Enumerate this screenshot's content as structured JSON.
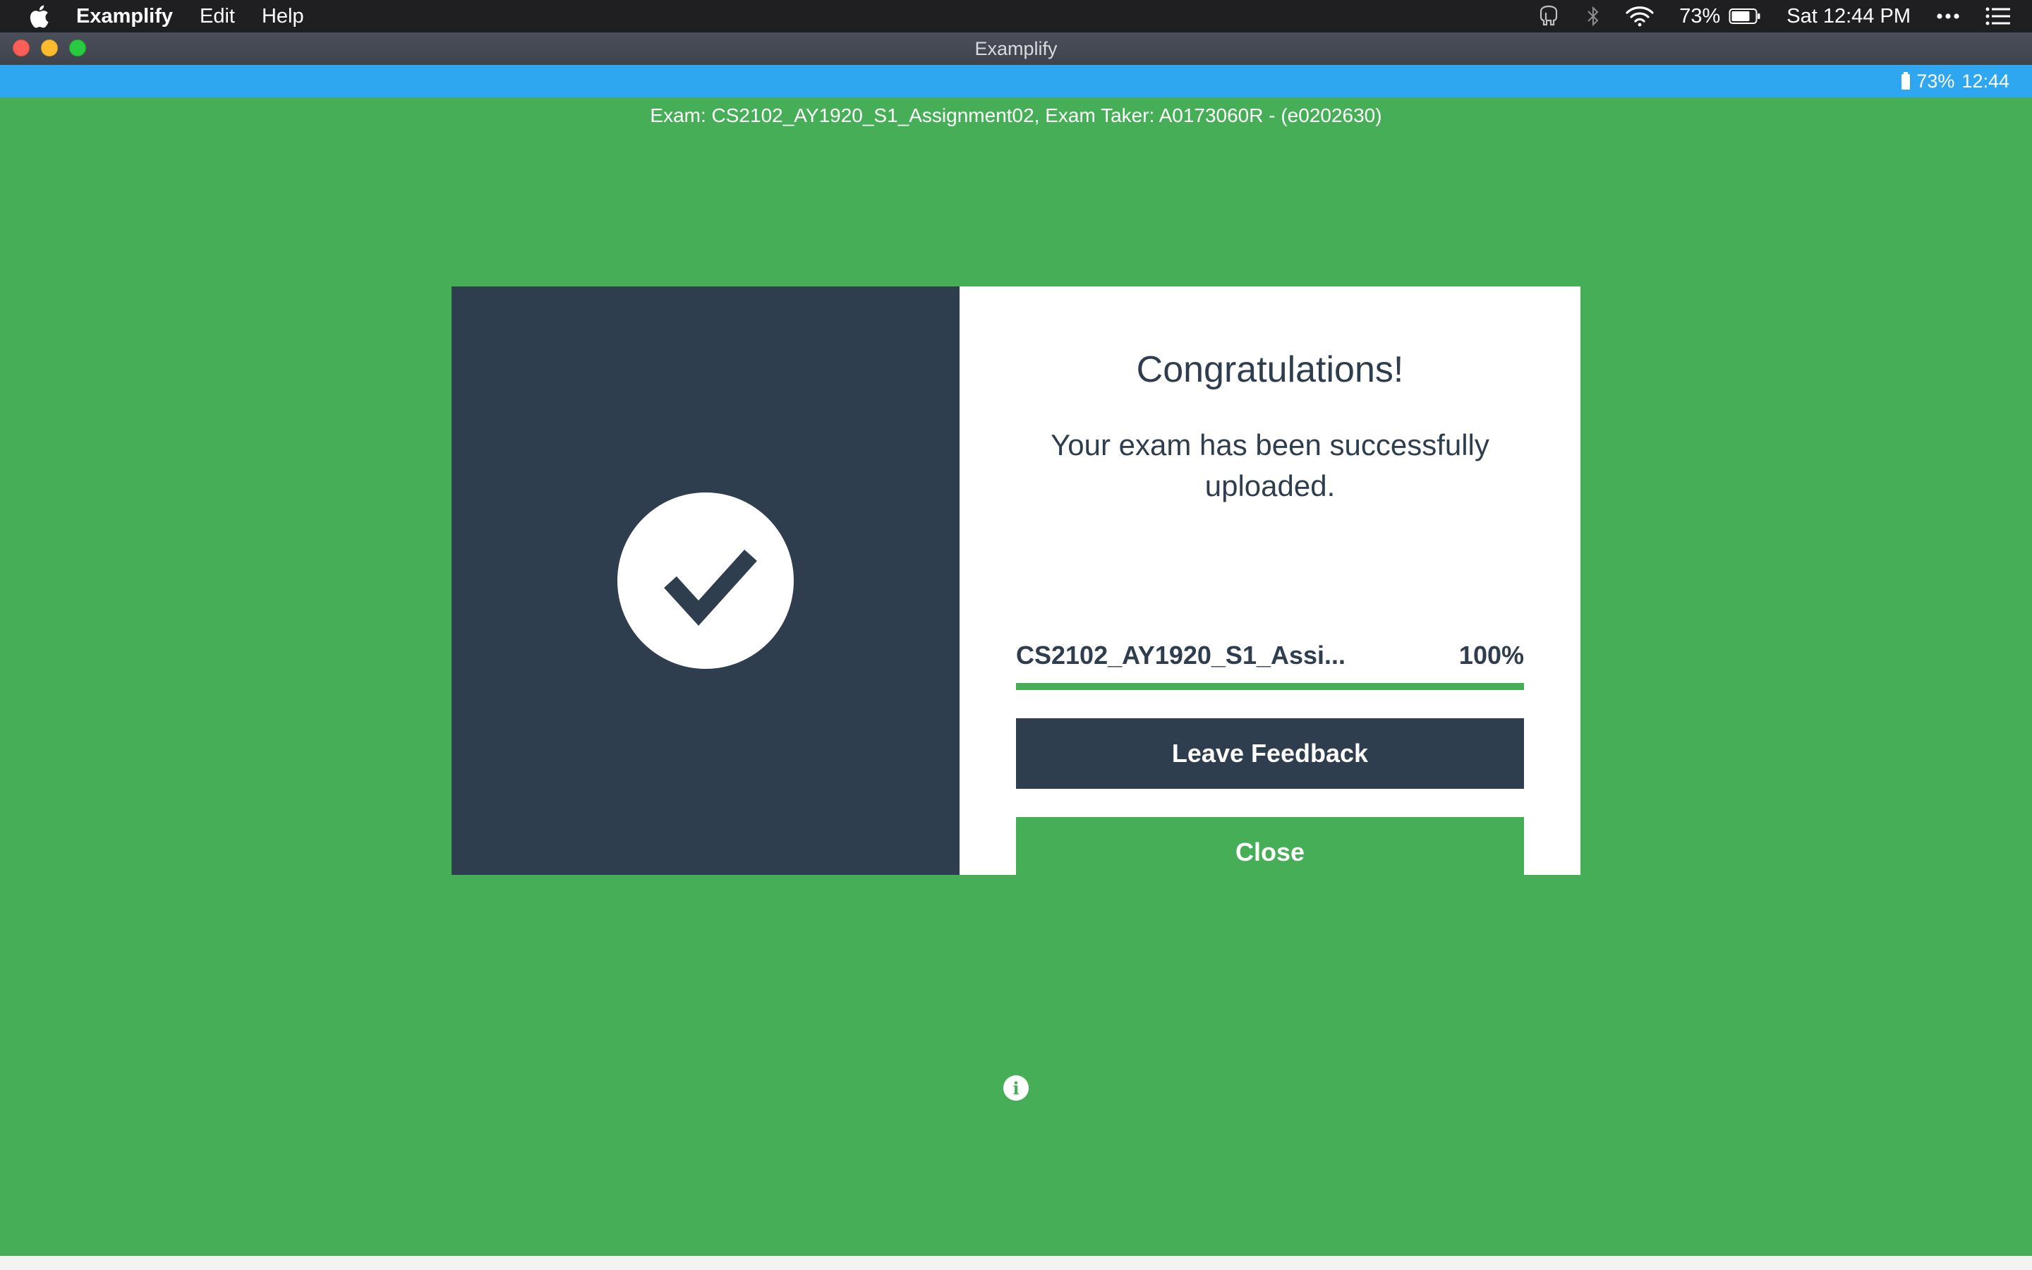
{
  "menubar": {
    "app_name": "Examplify",
    "menus": [
      "Edit",
      "Help"
    ],
    "battery_percent": "73%",
    "clock": "Sat 12:44 PM"
  },
  "window": {
    "title": "Examplify"
  },
  "app_strip": {
    "battery": "73%",
    "time": "12:44"
  },
  "exam": {
    "info": "Exam: CS2102_AY1920_S1_Assignment02, Exam Taker: A0173060R - (e0202630)"
  },
  "dialog": {
    "heading": "Congratulations!",
    "message": "Your exam has been successfully uploaded.",
    "file_name": "CS2102_AY1920_S1_Assi...",
    "progress_label": "100%",
    "progress_value": 100,
    "feedback_label": "Leave Feedback",
    "close_label": "Close",
    "icon": "checkmark-icon"
  },
  "footer": {
    "info_icon": "i"
  },
  "colors": {
    "green": "#46ae56",
    "navy": "#2f3e4e",
    "blue": "#2fa6f0"
  }
}
